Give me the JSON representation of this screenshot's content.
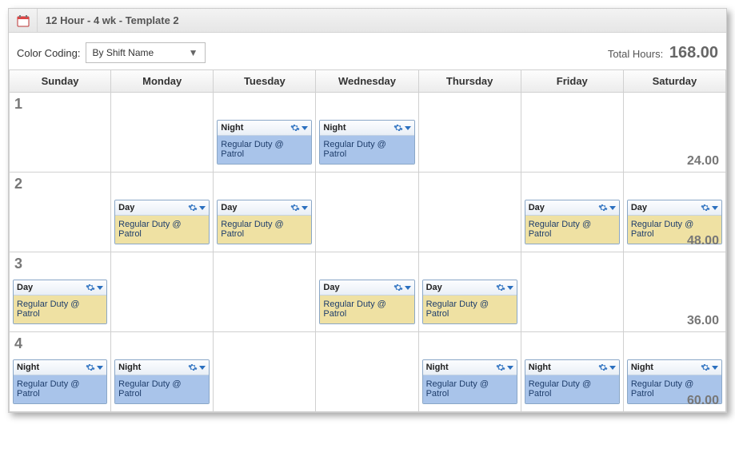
{
  "title": "12 Hour - 4 wk - Template 2",
  "colorCoding": {
    "label": "Color Coding:",
    "value": "By Shift Name"
  },
  "totalHours": {
    "label": "Total Hours:",
    "value": "168.00"
  },
  "days": [
    "Sunday",
    "Monday",
    "Tuesday",
    "Wednesday",
    "Thursday",
    "Friday",
    "Saturday"
  ],
  "shiftTypes": {
    "day": {
      "name": "Day",
      "body": "Regular Duty @ Patrol",
      "class": "day"
    },
    "night": {
      "name": "Night",
      "body": "Regular Duty @ Patrol",
      "class": "night"
    }
  },
  "weeks": [
    {
      "num": "1",
      "total": "24.00",
      "cells": [
        null,
        null,
        "night",
        "night",
        null,
        null,
        null
      ]
    },
    {
      "num": "2",
      "total": "48.00",
      "cells": [
        null,
        "day",
        "day",
        null,
        null,
        "day",
        "day"
      ]
    },
    {
      "num": "3",
      "total": "36.00",
      "cells": [
        "day",
        null,
        null,
        "day",
        "day",
        null,
        null
      ]
    },
    {
      "num": "4",
      "total": "60.00",
      "cells": [
        "night",
        "night",
        null,
        null,
        "night",
        "night",
        "night"
      ]
    }
  ]
}
